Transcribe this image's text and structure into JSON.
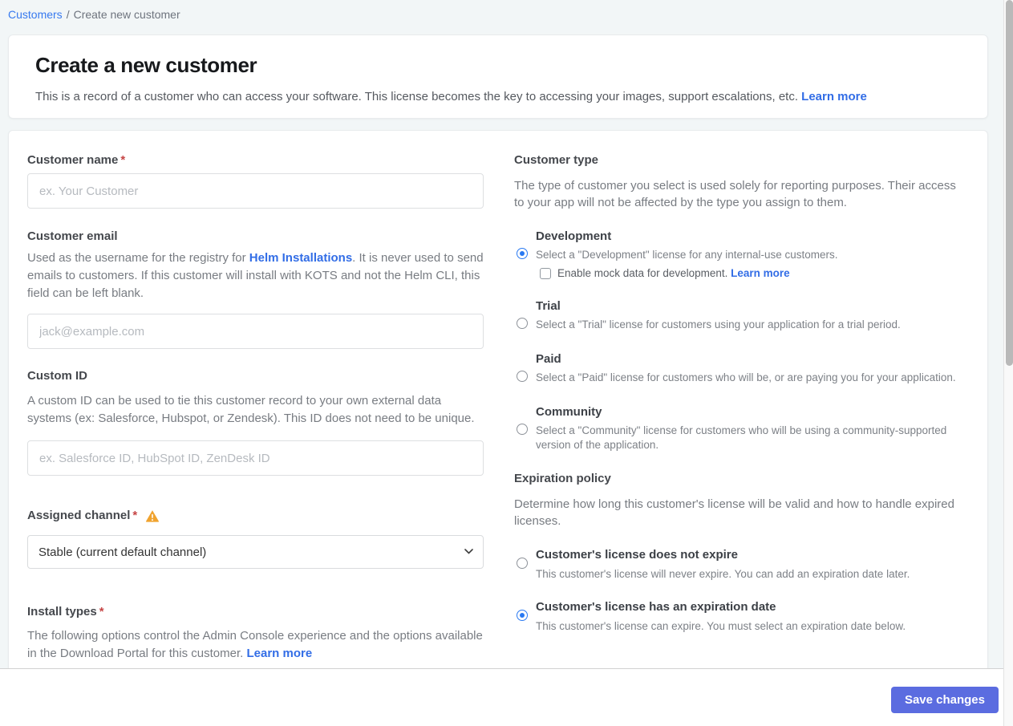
{
  "breadcrumb": {
    "customers": "Customers",
    "separator": "/",
    "current": "Create new customer"
  },
  "header": {
    "title": "Create a new customer",
    "description": "This is a record of a customer who can access your software. This license becomes the key to accessing your images, support escalations, etc.",
    "learn_more": "Learn more"
  },
  "left": {
    "customer_name": {
      "label": "Customer name",
      "required": "*",
      "value": "",
      "placeholder": "ex. Your Customer"
    },
    "customer_email": {
      "label": "Customer email",
      "desc_before": "Used as the username for the registry for ",
      "desc_link": "Helm Installations",
      "desc_after": ". It is never used to send emails to customers. If this customer will install with KOTS and not the Helm CLI, this field can be left blank.",
      "value": "",
      "placeholder": "jack@example.com"
    },
    "custom_id": {
      "label": "Custom ID",
      "description": "A custom ID can be used to tie this customer record to your own external data systems (ex: Salesforce, Hubspot, or Zendesk). This ID does not need to be unique.",
      "value": "",
      "placeholder": "ex. Salesforce ID, HubSpot ID, ZenDesk ID"
    },
    "assigned_channel": {
      "label": "Assigned channel",
      "required": "*",
      "has_warning": true,
      "selected_option": "Stable (current default channel)"
    },
    "install_types": {
      "label": "Install types",
      "required": "*",
      "description": "The following options control the Admin Console experience and the options available in the Download Portal for this customer.",
      "learn_more": "Learn more"
    }
  },
  "right": {
    "customer_type": {
      "heading": "Customer type",
      "description": "The type of customer you select is used solely for reporting purposes. Their access to your app will not be affected by the type you assign to them.",
      "options": [
        {
          "title": "Development",
          "description": "Select a \"Development\" license for any internal-use customers.",
          "selected": true,
          "checkbox": {
            "label": "Enable mock data for development.",
            "learn_more": "Learn more",
            "checked": false
          }
        },
        {
          "title": "Trial",
          "description": "Select a \"Trial\" license for customers using your application for a trial period.",
          "selected": false
        },
        {
          "title": "Paid",
          "description": "Select a \"Paid\" license for customers who will be, or are paying you for your application.",
          "selected": false
        },
        {
          "title": "Community",
          "description": "Select a \"Community\" license for customers who will be using a community-supported version of the application.",
          "selected": false
        }
      ]
    },
    "expiration_policy": {
      "heading": "Expiration policy",
      "description": "Determine how long this customer's license will be valid and how to handle expired licenses.",
      "options": [
        {
          "title": "Customer's license does not expire",
          "description": "This customer's license will never expire. You can add an expiration date later.",
          "selected": false
        },
        {
          "title": "Customer's license has an expiration date",
          "description": "This customer's license can expire. You must select an expiration date below.",
          "selected": true
        }
      ]
    }
  },
  "footer": {
    "save_label": "Save changes"
  },
  "colors": {
    "accent_link": "#326de6",
    "radio_selected": "#2979f2",
    "save_button": "#5b6ce0",
    "warning": "#f0a32f",
    "required_asterisk": "#c64545",
    "page_background": "#f2f6f7"
  }
}
